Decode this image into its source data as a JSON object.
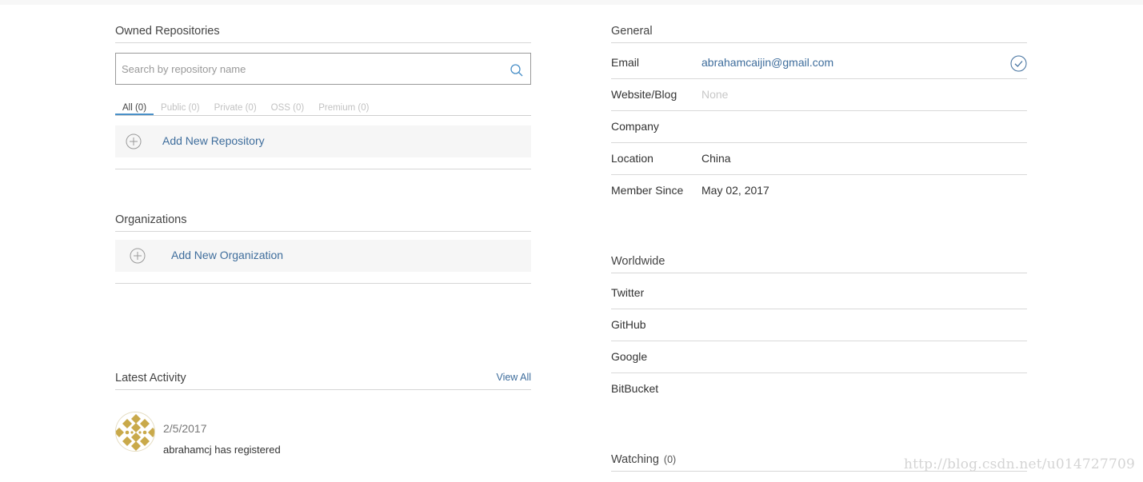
{
  "left": {
    "owned_repositories": {
      "title": "Owned Repositories",
      "search_placeholder": "Search by repository name",
      "tabs": [
        {
          "label": "All (0)",
          "active": true
        },
        {
          "label": "Public (0)",
          "active": false
        },
        {
          "label": "Private (0)",
          "active": false
        },
        {
          "label": "OSS (0)",
          "active": false
        },
        {
          "label": "Premium (0)",
          "active": false
        }
      ],
      "add_label": "Add New Repository"
    },
    "organizations": {
      "title": "Organizations",
      "add_label": "Add New Organization"
    },
    "latest_activity": {
      "title": "Latest Activity",
      "view_all": "View All",
      "items": [
        {
          "date": "2/5/2017",
          "text": "abrahamcj has registered"
        }
      ]
    }
  },
  "right": {
    "general": {
      "title": "General",
      "rows": [
        {
          "key": "Email",
          "value": "abrahamcaijin@gmail.com"
        },
        {
          "key": "Website/Blog",
          "value": "None"
        },
        {
          "key": "Company",
          "value": ""
        },
        {
          "key": "Location",
          "value": "China"
        },
        {
          "key": "Member Since",
          "value": "May 02, 2017"
        }
      ]
    },
    "worldwide": {
      "title": "Worldwide",
      "rows": [
        {
          "key": "Twitter"
        },
        {
          "key": "GitHub"
        },
        {
          "key": "Google"
        },
        {
          "key": "BitBucket"
        }
      ]
    },
    "watching": {
      "title": "Watching",
      "count": "(0)"
    }
  },
  "watermark": "http://blog.csdn.net/u014727709",
  "colors": {
    "link": "#3e6d9c",
    "tab_active_underline": "#4a90c8",
    "avatar_gold": "#c9a94a"
  },
  "icons": [
    "search-icon",
    "plus-circle-icon",
    "check-circle-icon",
    "identicon-avatar"
  ]
}
